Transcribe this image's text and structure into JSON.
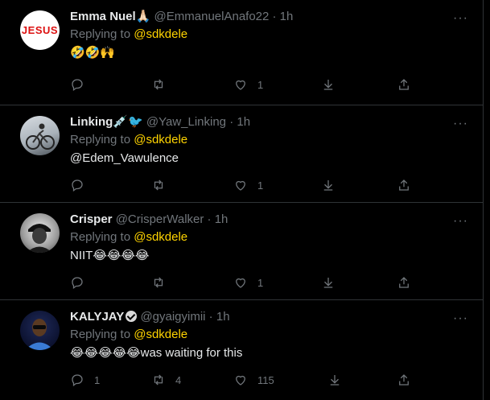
{
  "tweets": [
    {
      "name": "Emma Nuel🙏🏻",
      "handle": "@EmmanuelAnafo22 · 1h",
      "reply_prefix": "Replying to ",
      "reply_to": "@sdkdele",
      "text": "🤣🤣🙌",
      "avatar_text": "JESUS",
      "likes": "1",
      "replies": "",
      "retweets": ""
    },
    {
      "name": "Linking💉🐦",
      "handle": "@Yaw_Linking · 1h",
      "reply_prefix": "Replying to ",
      "reply_to": "@sdkdele",
      "text": "@Edem_Vawulence",
      "likes": "1",
      "replies": "",
      "retweets": ""
    },
    {
      "name": "Crisper",
      "handle": "@CrisperWalker · 1h",
      "reply_prefix": "Replying to ",
      "reply_to": "@sdkdele",
      "text": "NIIT😂😂😂😂",
      "likes": "1",
      "replies": "",
      "retweets": ""
    },
    {
      "name": "KALYJAY",
      "handle": "@gyaigyimii · 1h",
      "reply_prefix": "Replying to ",
      "reply_to": "@sdkdele",
      "text": "😂😂😂😂😂was waiting for this",
      "likes": "115",
      "replies": "1",
      "retweets": "4"
    }
  ],
  "colors": {
    "accent": "#ffd400",
    "muted": "#71767b",
    "divider": "#2f3336"
  },
  "icons": [
    "reply-icon",
    "retweet-icon",
    "like-icon",
    "download-icon",
    "share-icon",
    "more-icon",
    "verified-icon"
  ]
}
